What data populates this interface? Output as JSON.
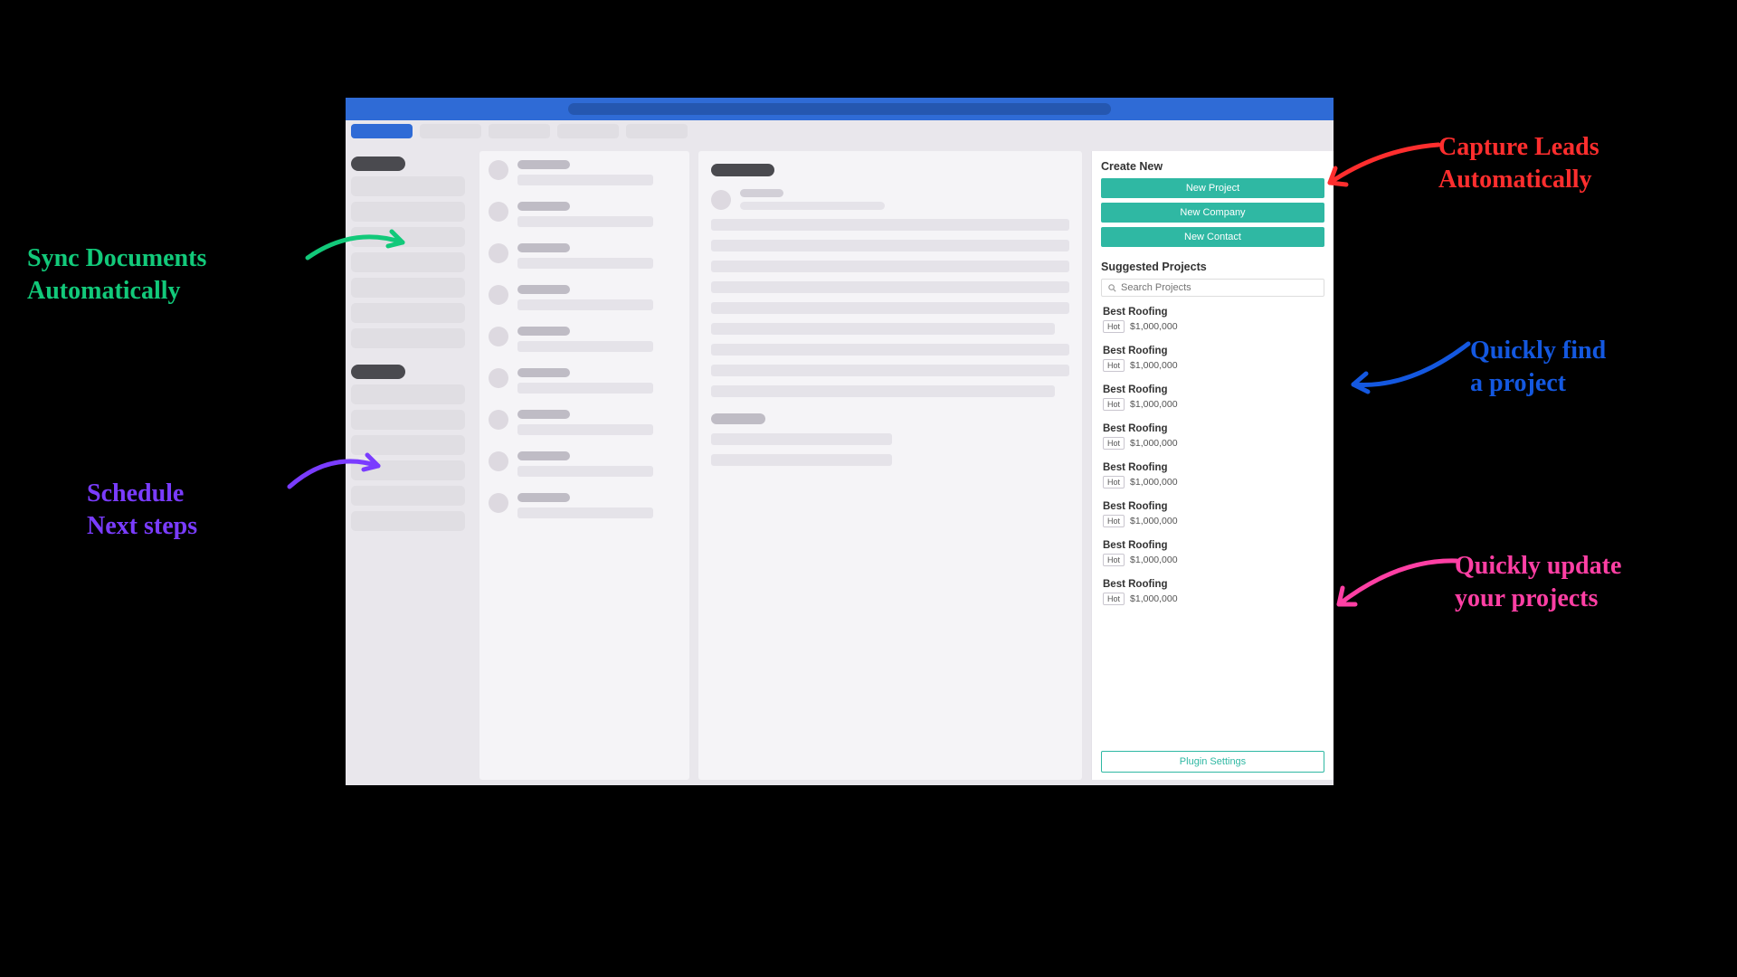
{
  "plugin": {
    "create_heading": "Create New",
    "buttons": {
      "new_project": "New Project",
      "new_company": "New Company",
      "new_contact": "New Contact"
    },
    "suggested_heading": "Suggested Projects",
    "search_placeholder": "Search Projects",
    "settings_label": "Plugin Settings",
    "projects": [
      {
        "name": "Best Roofing",
        "badge": "Hot",
        "amount": "$1,000,000"
      },
      {
        "name": "Best Roofing",
        "badge": "Hot",
        "amount": "$1,000,000"
      },
      {
        "name": "Best Roofing",
        "badge": "Hot",
        "amount": "$1,000,000"
      },
      {
        "name": "Best Roofing",
        "badge": "Hot",
        "amount": "$1,000,000"
      },
      {
        "name": "Best Roofing",
        "badge": "Hot",
        "amount": "$1,000,000"
      },
      {
        "name": "Best Roofing",
        "badge": "Hot",
        "amount": "$1,000,000"
      },
      {
        "name": "Best Roofing",
        "badge": "Hot",
        "amount": "$1,000,000"
      },
      {
        "name": "Best Roofing",
        "badge": "Hot",
        "amount": "$1,000,000"
      }
    ]
  },
  "annotations": {
    "sync_docs": "Sync Documents\nAutomatically",
    "schedule": "Schedule\nNext steps",
    "capture": "Capture Leads\nAutomatically",
    "find": "Quickly find\na project",
    "update": "Quickly update\nyour projects"
  },
  "colors": {
    "primary": "#2fb8a3",
    "ribbon": "#2f6bd6"
  }
}
